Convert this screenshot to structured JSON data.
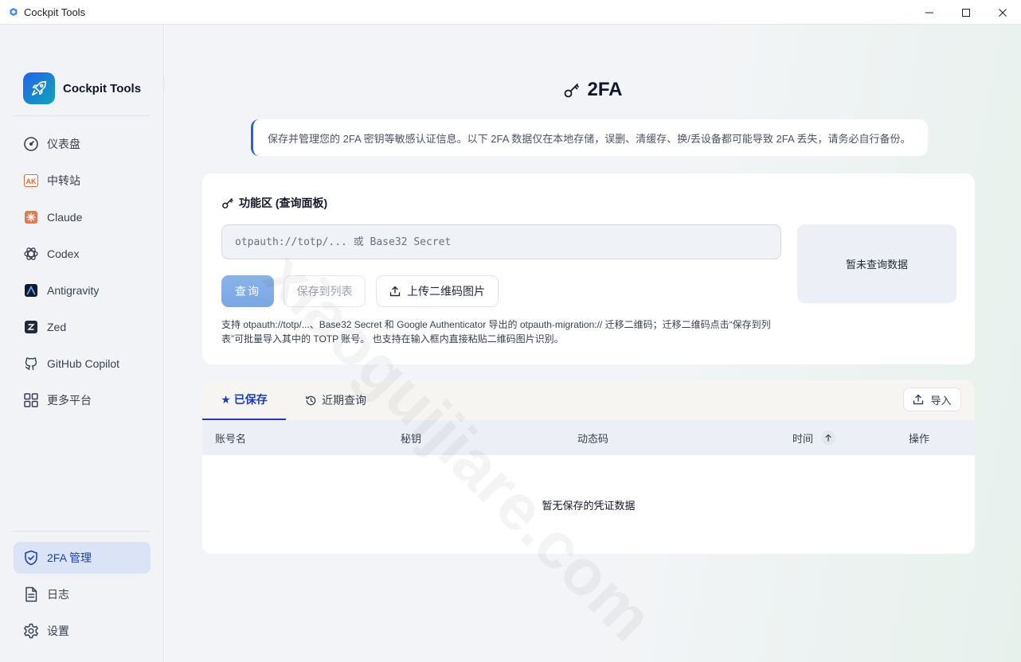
{
  "window": {
    "title": "Cockpit Tools"
  },
  "sidebar": {
    "brand": "Cockpit Tools",
    "items": [
      {
        "label": "仪表盘",
        "icon": "gauge-icon"
      },
      {
        "label": "中转站",
        "icon": "ak-badge-icon"
      },
      {
        "label": "Claude",
        "icon": "claude-icon"
      },
      {
        "label": "Codex",
        "icon": "openai-icon"
      },
      {
        "label": "Antigravity",
        "icon": "antigravity-icon"
      },
      {
        "label": "Zed",
        "icon": "zed-icon"
      },
      {
        "label": "GitHub Copilot",
        "icon": "github-icon"
      },
      {
        "label": "更多平台",
        "icon": "grid-icon"
      }
    ],
    "bottom_items": [
      {
        "label": "2FA 管理",
        "icon": "shield-icon",
        "active": true
      },
      {
        "label": "日志",
        "icon": "document-icon"
      },
      {
        "label": "设置",
        "icon": "gear-icon"
      }
    ]
  },
  "page": {
    "title": "2FA",
    "notice": "保存并管理您的 2FA 密钥等敏感认证信息。以下 2FA 数据仅在本地存储，误删、清缓存、换/丢设备都可能导致 2FA 丢失，请务必自行备份。"
  },
  "function_panel": {
    "title": "功能区 (查询面板)",
    "input_placeholder": "otpauth://totp/... 或 Base32 Secret",
    "query_button": "查询",
    "save_button": "保存到列表",
    "upload_button": "上传二维码图片",
    "help_text": "支持 otpauth://totp/...、Base32 Secret 和 Google Authenticator 导出的 otpauth-migration:// 迁移二维码；迁移二维码点击“保存到列表”可批量导入其中的 TOTP 账号。 也支持在输入框内直接粘贴二维码图片识别。",
    "result_empty": "暂未查询数据"
  },
  "list_panel": {
    "tabs": [
      {
        "label": "★ 已保存",
        "active": true
      },
      {
        "label": "近期查询",
        "active": false
      }
    ],
    "import_button": "导入",
    "columns": [
      "账号名",
      "秘钥",
      "动态码",
      "时间",
      "操作"
    ],
    "empty_text": "暂无保存的凭证数据"
  },
  "watermark": "xiaoguijiare.com",
  "colors": {
    "accent": "#1e40af",
    "primary_button": "#7aa6e2",
    "notice_border": "#2f5fd0"
  }
}
